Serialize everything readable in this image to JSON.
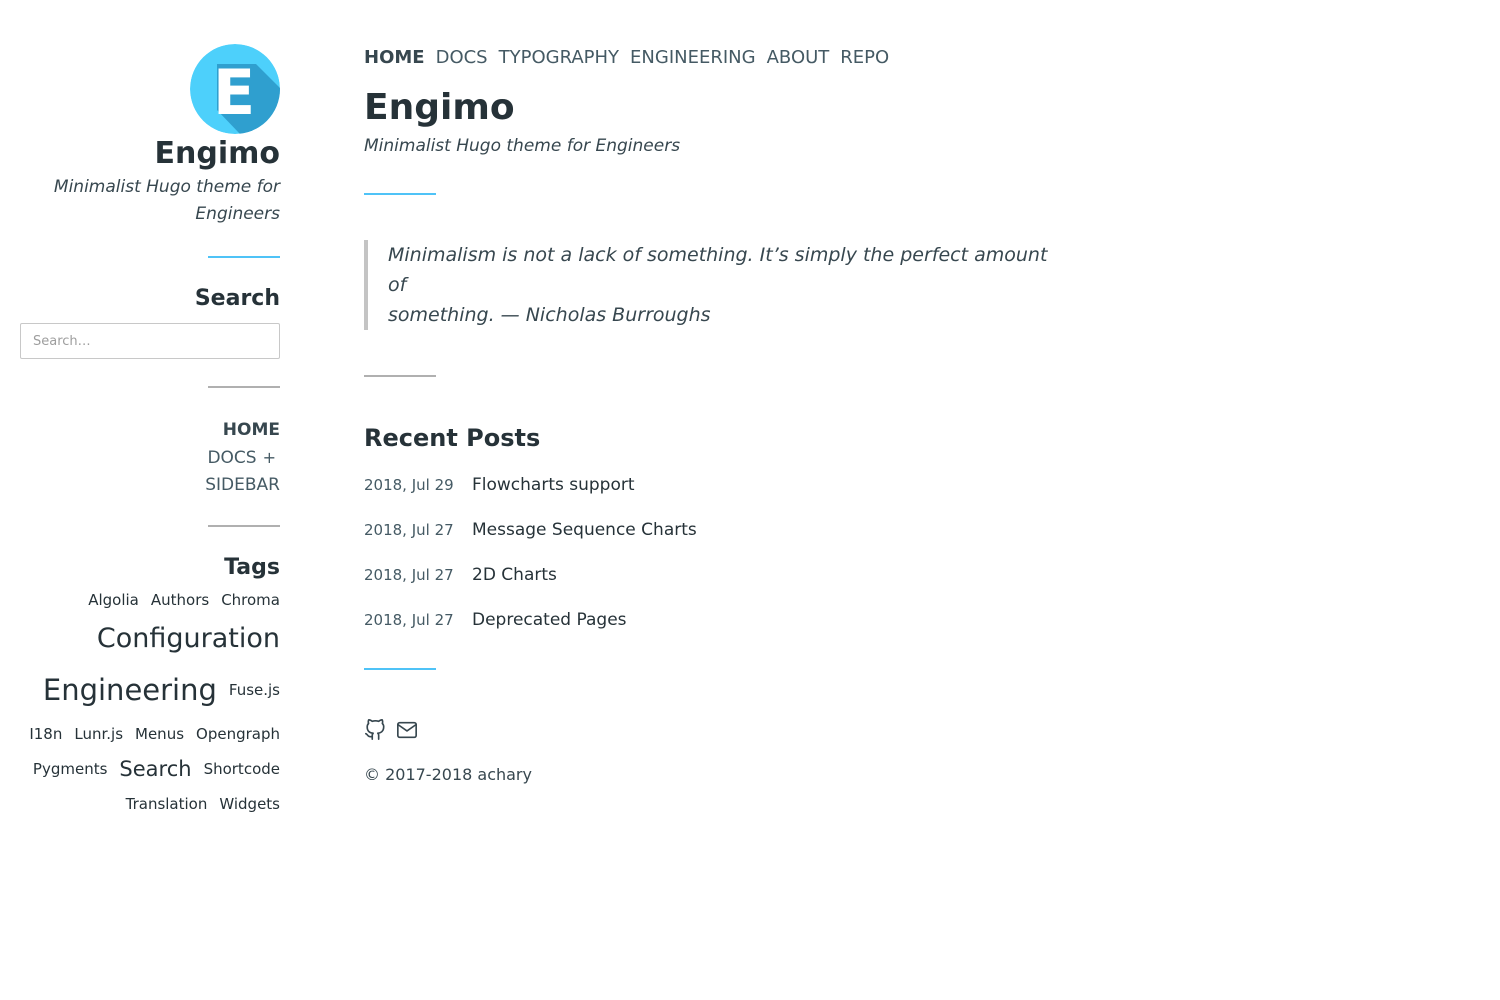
{
  "brand": {
    "logo_letter": "E",
    "title": "Engimo",
    "subtitle_line1": "Minimalist Hugo theme for",
    "subtitle_line2": "Engineers"
  },
  "sidebar": {
    "search_heading": "Search",
    "search_placeholder": "Search…",
    "nav": [
      {
        "label": "HOME",
        "active": true
      },
      {
        "label": "DOCS",
        "expand": "+"
      },
      {
        "label": "SIDEBAR"
      }
    ],
    "tags_heading": "Tags",
    "tags": {
      "algolia": "Algolia",
      "authors": "Authors",
      "chroma": "Chroma",
      "configuration": "Configuration",
      "engineering": "Engineering",
      "fusejs": "Fuse.js",
      "i18n": "I18n",
      "lunrjs": "Lunr.js",
      "menus": "Menus",
      "opengraph": "Opengraph",
      "pygments": "Pygments",
      "search": "Search",
      "shortcode": "Shortcode",
      "translation": "Translation",
      "widgets": "Widgets"
    }
  },
  "topnav": [
    {
      "label": "HOME",
      "active": true
    },
    {
      "label": "DOCS"
    },
    {
      "label": "TYPOGRAPHY"
    },
    {
      "label": "ENGINEERING"
    },
    {
      "label": "ABOUT"
    },
    {
      "label": "REPO"
    }
  ],
  "main": {
    "title": "Engimo",
    "subtitle": "Minimalist Hugo theme for Engineers",
    "quote_line1": "Minimalism is not a lack of something. It’s simply the perfect amount of",
    "quote_line2": "something. — Nicholas Burroughs",
    "recent_heading": "Recent Posts",
    "posts": [
      {
        "date": "2018, Jul 29",
        "title": "Flowcharts support"
      },
      {
        "date": "2018, Jul 27",
        "title": "Message Sequence Charts"
      },
      {
        "date": "2018, Jul 27",
        "title": "2D Charts"
      },
      {
        "date": "2018, Jul 27",
        "title": "Deprecated Pages"
      }
    ]
  },
  "footer": {
    "icons": [
      "github-icon",
      "mail-icon"
    ],
    "copyright": "© 2017-2018 achary"
  },
  "colors": {
    "accent": "#4fc3f7",
    "logo_light": "#4dd0fb",
    "logo_shadow": "#2f9fcf",
    "text": "#263238",
    "nav_text": "#455a64"
  }
}
